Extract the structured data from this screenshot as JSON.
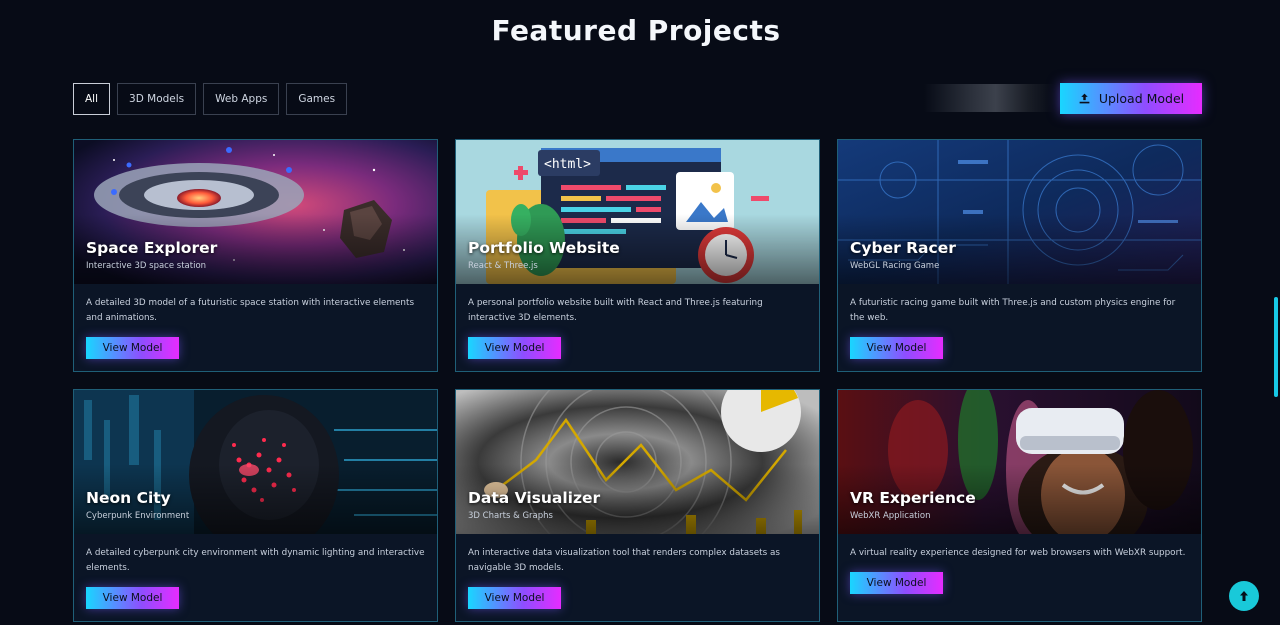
{
  "header": {
    "title": "Featured Projects"
  },
  "filters": [
    {
      "label": "All",
      "active": true
    },
    {
      "label": "3D Models",
      "active": false
    },
    {
      "label": "Web Apps",
      "active": false
    },
    {
      "label": "Games",
      "active": false
    }
  ],
  "upload": {
    "label": "Upload Model",
    "icon": "upload-icon"
  },
  "projects": [
    {
      "title": "Space Explorer",
      "subtitle": "Interactive 3D space station",
      "description": "A detailed 3D model of a futuristic space station with interactive elements and animations.",
      "button": "View Model"
    },
    {
      "title": "Portfolio Website",
      "subtitle": "React & Three.js",
      "description": "A personal portfolio website built with React and Three.js featuring interactive 3D elements.",
      "button": "View Model"
    },
    {
      "title": "Cyber Racer",
      "subtitle": "WebGL Racing Game",
      "description": "A futuristic racing game built with Three.js and custom physics engine for the web.",
      "button": "View Model"
    },
    {
      "title": "Neon City",
      "subtitle": "Cyberpunk Environment",
      "description": "A detailed cyberpunk city environment with dynamic lighting and interactive elements.",
      "button": "View Model"
    },
    {
      "title": "Data Visualizer",
      "subtitle": "3D Charts & Graphs",
      "description": "An interactive data visualization tool that renders complex datasets as navigable 3D models.",
      "button": "View Model"
    },
    {
      "title": "VR Experience",
      "subtitle": "WebXR Application",
      "description": "A virtual reality experience designed for web browsers with WebXR support.",
      "button": "View Model"
    }
  ],
  "back_to_top": {
    "icon": "arrow-up-icon"
  },
  "colors": {
    "accent_start": "#19d6ff",
    "accent_end": "#e62cff",
    "card_border": "#1f5f78",
    "background": "#070b16"
  }
}
